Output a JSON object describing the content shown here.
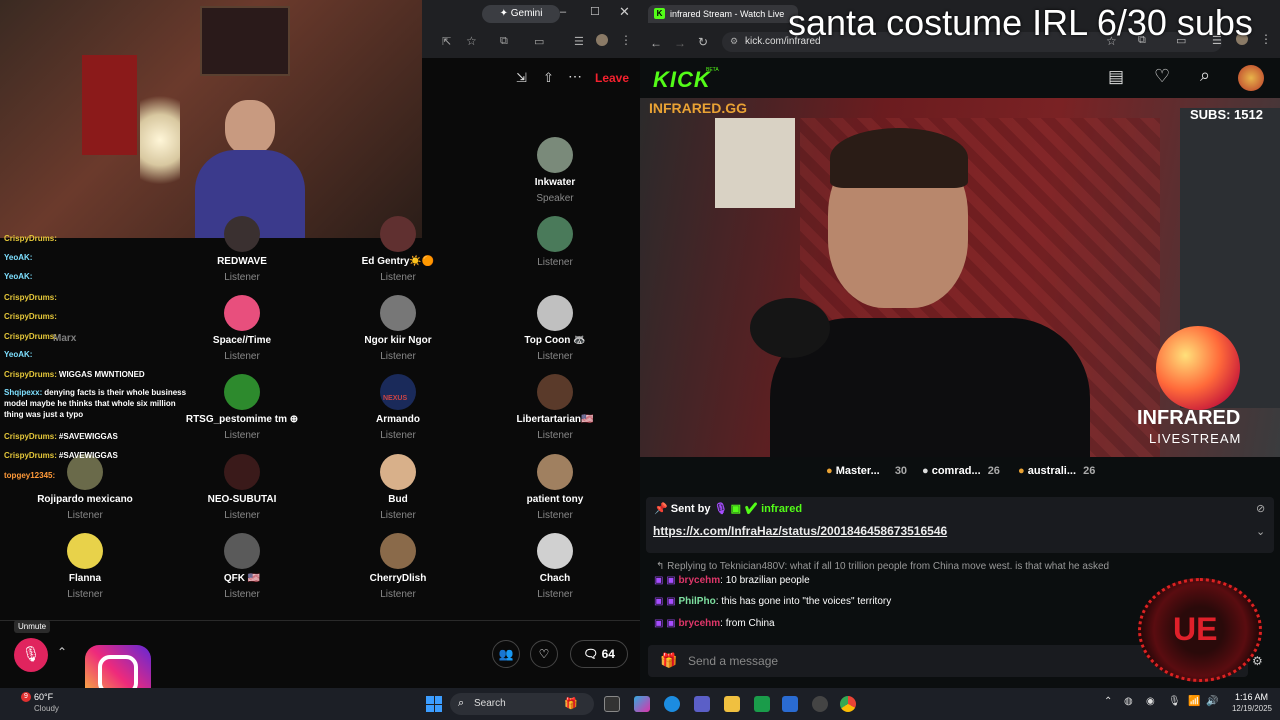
{
  "overlay_title": "santa costume IRL 6/30 subs",
  "left_browser": {
    "gemini": "Gemini"
  },
  "space": {
    "leave": "Leave",
    "unmute": "Unmute",
    "reactions_count": "64",
    "people": [
      {
        "name": "Inkwater",
        "role": "Speaker"
      },
      {
        "name": "REDWAVE",
        "role": "Listener"
      },
      {
        "name": "Ed Gentry☀️🟠",
        "role": "Listener"
      },
      {
        "name": "",
        "role": "Listener"
      },
      {
        "name": "Space//Time",
        "role": "Listener"
      },
      {
        "name": "Ngor kiir Ngor",
        "role": "Listener"
      },
      {
        "name": "Top Coon 🦝",
        "role": "Listener"
      },
      {
        "name": "RTSG_pestomime tm ⊕",
        "role": "Listener"
      },
      {
        "name": "Armando",
        "role": "Listener"
      },
      {
        "name": "Libertartarian🇺🇸",
        "role": "Listener"
      },
      {
        "name": "Rojipardo mexicano",
        "role": "Listener"
      },
      {
        "name": "NEO-SUBUTAI",
        "role": "Listener"
      },
      {
        "name": "Bud",
        "role": "Listener"
      },
      {
        "name": "patient tony",
        "role": "Listener"
      },
      {
        "name": "Flanna",
        "role": "Listener"
      },
      {
        "name": "QFK 🇺🇸",
        "role": "Listener"
      },
      {
        "name": "CherryDlish",
        "role": "Listener"
      },
      {
        "name": "Chach",
        "role": "Listener"
      }
    ],
    "nexus": "NEXUS",
    "marx": "Marx"
  },
  "overlay_chat": [
    {
      "user": "CrispyDrums:",
      "msg": ""
    },
    {
      "user": "YeoAK:",
      "msg": ""
    },
    {
      "user": "YeoAK:",
      "msg": ""
    },
    {
      "user": "CrispyDrums:",
      "msg": ""
    },
    {
      "user": "CrispyDrums:",
      "msg": ""
    },
    {
      "user": "CrispyDrums:",
      "msg": ""
    },
    {
      "user": "YeoAK:",
      "msg": ""
    },
    {
      "user": "CrispyDrums:",
      "msg": "WIGGAS MWNTIONED"
    },
    {
      "user": "Shqipexx:",
      "msg": "denying facts is their whole business model maybe he thinks that whole six million thing was just a typo"
    },
    {
      "user": "CrispyDrums:",
      "msg": "#SAVEWIGGAS"
    },
    {
      "user": "CrispyDrums:",
      "msg": "#SAVEWIGGAS"
    },
    {
      "user": "topgey12345:",
      "msg": ""
    }
  ],
  "right_browser": {
    "tab_title": "infrared Stream - Watch Live",
    "url": "kick.com/infrared"
  },
  "kick": {
    "logo": "KICK",
    "beta": "BETA",
    "infrared_gg": "INFRARED.GG",
    "subs": "SUBS: 1512",
    "brand_line1": "INFRARED",
    "brand_line2": "LIVESTREAM",
    "gifters": [
      {
        "name": "Master...",
        "count": "30"
      },
      {
        "name": "comrad...",
        "count": "26"
      },
      {
        "name": "australi...",
        "count": "26"
      }
    ],
    "pinned_by_label": "Sent by",
    "pinned_user": "infrared",
    "pinned_link": "https://x.com/InfraHaz/status/2001846458673516546",
    "reply_text": "Replying to Teknician480V: what if all 10 trillion people from China move west. is that what he asked",
    "chat": [
      {
        "user": "brycehm",
        "msg": "10 brazilian people",
        "color": "#e0376a"
      },
      {
        "user": "PhilPho",
        "msg": "this has gone into \"the voices\" territory",
        "color": "#7ee0a0"
      },
      {
        "user": "brycehm",
        "msg": "from China",
        "color": "#e0376a"
      }
    ],
    "send_placeholder": "Send a message",
    "accent": "#53fc18"
  },
  "taskbar": {
    "weather_temp": "60°F",
    "weather_desc": "Cloudy",
    "weather_badge": "9",
    "search": "Search",
    "time": "1:16 AM",
    "date": "12/19/2025"
  }
}
